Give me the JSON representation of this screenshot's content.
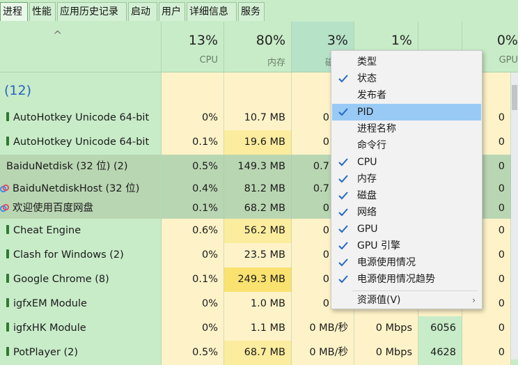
{
  "tabs": [
    "进程",
    "性能",
    "应用历史记录",
    "启动",
    "用户",
    "详细信息",
    "服务"
  ],
  "header": {
    "sort_arrow": "^",
    "cpu": {
      "pct": "13%",
      "label": "CPU"
    },
    "mem": {
      "pct": "80%",
      "label": "内存"
    },
    "disk": {
      "pct": "3%",
      "label": "磁"
    },
    "net": {
      "pct": "1%",
      "label": ""
    },
    "gpu": {
      "pct": "0%",
      "label": "GPU"
    }
  },
  "group_label": "(12)",
  "rows": [
    {
      "name": "AutoHotkey Unicode 64-bit",
      "cpu": "0%",
      "mem": "10.7 MB",
      "disk": "0 MB",
      "net": "",
      "pid": "",
      "gpu": "0"
    },
    {
      "name": "AutoHotkey Unicode 64-bit",
      "cpu": "0.1%",
      "mem": "19.6 MB",
      "disk": "0 MB",
      "net": "",
      "pid": "",
      "gpu": "0"
    },
    {
      "name": "BaiduNetdisk (32 位) (2)",
      "cpu": "0.5%",
      "mem": "149.3 MB",
      "disk": "0.7 MB",
      "net": "",
      "pid": "",
      "gpu": "0"
    },
    {
      "name": "BaiduNetdiskHost (32 位)",
      "cpu": "0.4%",
      "mem": "81.2 MB",
      "disk": "0.7 MB",
      "net": "",
      "pid": "",
      "gpu": "0"
    },
    {
      "name": "欢迎使用百度网盘",
      "cpu": "0.1%",
      "mem": "68.2 MB",
      "disk": "0 MB",
      "net": "",
      "pid": "",
      "gpu": "0"
    },
    {
      "name": "Cheat Engine",
      "cpu": "0.6%",
      "mem": "56.2 MB",
      "disk": "0 MB",
      "net": "",
      "pid": "",
      "gpu": "0"
    },
    {
      "name": "Clash for Windows (2)",
      "cpu": "0%",
      "mem": "23.5 MB",
      "disk": "0 MB",
      "net": "",
      "pid": "",
      "gpu": "0"
    },
    {
      "name": "Google Chrome (8)",
      "cpu": "0.1%",
      "mem": "249.3 MB",
      "disk": "0 MB",
      "net": "",
      "pid": "",
      "gpu": "0"
    },
    {
      "name": "igfxEM Module",
      "cpu": "0%",
      "mem": "1.0 MB",
      "disk": "0 MB",
      "net": "",
      "pid": "",
      "gpu": "0"
    },
    {
      "name": "igfxHK Module",
      "cpu": "0%",
      "mem": "1.1 MB",
      "disk": "0 MB/秒",
      "net": "0 Mbps",
      "pid": "6056",
      "gpu": "0"
    },
    {
      "name": "PotPlayer (2)",
      "cpu": "0.5%",
      "mem": "68.7 MB",
      "disk": "0 MB/秒",
      "net": "0 Mbps",
      "pid": "4628",
      "gpu": "0"
    }
  ],
  "menu": {
    "items": [
      {
        "label": "类型",
        "checked": false
      },
      {
        "label": "状态",
        "checked": true
      },
      {
        "label": "发布者",
        "checked": false
      },
      {
        "label": "PID",
        "checked": true
      },
      {
        "label": "进程名称",
        "checked": false
      },
      {
        "label": "命令行",
        "checked": false
      },
      {
        "label": "CPU",
        "checked": true
      },
      {
        "label": "内存",
        "checked": true
      },
      {
        "label": "磁盘",
        "checked": true
      },
      {
        "label": "网络",
        "checked": true
      },
      {
        "label": "GPU",
        "checked": true
      },
      {
        "label": "GPU 引擎",
        "checked": true
      },
      {
        "label": "电源使用情况",
        "checked": true
      },
      {
        "label": "电源使用情况趋势",
        "checked": true
      }
    ],
    "resource_values": "资源值(V)",
    "submenu_arrow": "›"
  },
  "colors": {
    "highlight": "#99caf5",
    "check": "#2467c7",
    "background": "#c8ecc8"
  }
}
